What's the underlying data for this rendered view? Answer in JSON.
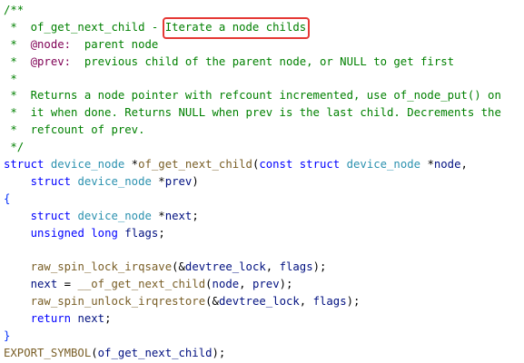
{
  "colors": {
    "background": "#ffffff",
    "comment": "#008000",
    "doc_tag": "#7f0055",
    "keyword": "#0000ff",
    "type": "#2b91af",
    "function": "#795e26",
    "variable": "#001080",
    "brace": "#0431fa",
    "highlight_box": "#e53935"
  },
  "code": {
    "lines": [
      {
        "tokens": [
          {
            "text": "/**",
            "cls": "c-comment"
          }
        ]
      },
      {
        "tokens": [
          {
            "text": " *  of_get_next_child - ",
            "cls": "c-comment"
          },
          {
            "text": "Iterate a node childs",
            "cls": "c-comment",
            "highlight": true
          }
        ]
      },
      {
        "tokens": [
          {
            "text": " *  ",
            "cls": "c-comment"
          },
          {
            "text": "@node:",
            "cls": "c-doctag"
          },
          {
            "text": "  parent node",
            "cls": "c-comment"
          }
        ]
      },
      {
        "tokens": [
          {
            "text": " *  ",
            "cls": "c-comment"
          },
          {
            "text": "@prev:",
            "cls": "c-doctag"
          },
          {
            "text": "  previous child of the parent node, or NULL to get first",
            "cls": "c-comment"
          }
        ]
      },
      {
        "tokens": [
          {
            "text": " *",
            "cls": "c-comment"
          }
        ]
      },
      {
        "tokens": [
          {
            "text": " *  Returns a node pointer with refcount incremented, use of_node_put() on",
            "cls": "c-comment"
          }
        ]
      },
      {
        "tokens": [
          {
            "text": " *  it when done. Returns NULL when prev is the last child. Decrements the",
            "cls": "c-comment"
          }
        ]
      },
      {
        "tokens": [
          {
            "text": " *  refcount of prev.",
            "cls": "c-comment"
          }
        ]
      },
      {
        "tokens": [
          {
            "text": " */",
            "cls": "c-comment"
          }
        ]
      },
      {
        "tokens": [
          {
            "text": "struct",
            "cls": "c-keyword"
          },
          {
            "text": " ",
            "cls": "c-punct"
          },
          {
            "text": "device_node",
            "cls": "c-type"
          },
          {
            "text": " *",
            "cls": "c-punct"
          },
          {
            "text": "of_get_next_child",
            "cls": "c-func"
          },
          {
            "text": "(",
            "cls": "c-punct"
          },
          {
            "text": "const",
            "cls": "c-keyword"
          },
          {
            "text": " ",
            "cls": "c-punct"
          },
          {
            "text": "struct",
            "cls": "c-keyword"
          },
          {
            "text": " ",
            "cls": "c-punct"
          },
          {
            "text": "device_node",
            "cls": "c-type"
          },
          {
            "text": " *",
            "cls": "c-punct"
          },
          {
            "text": "node",
            "cls": "c-var"
          },
          {
            "text": ",",
            "cls": "c-punct"
          }
        ]
      },
      {
        "tokens": [
          {
            "text": "    ",
            "cls": "c-punct"
          },
          {
            "text": "struct",
            "cls": "c-keyword"
          },
          {
            "text": " ",
            "cls": "c-punct"
          },
          {
            "text": "device_node",
            "cls": "c-type"
          },
          {
            "text": " *",
            "cls": "c-punct"
          },
          {
            "text": "prev",
            "cls": "c-var"
          },
          {
            "text": ")",
            "cls": "c-punct"
          }
        ]
      },
      {
        "tokens": [
          {
            "text": "{",
            "cls": "c-brace"
          }
        ]
      },
      {
        "tokens": [
          {
            "text": "    ",
            "cls": "c-punct"
          },
          {
            "text": "struct",
            "cls": "c-keyword"
          },
          {
            "text": " ",
            "cls": "c-punct"
          },
          {
            "text": "device_node",
            "cls": "c-type"
          },
          {
            "text": " *",
            "cls": "c-punct"
          },
          {
            "text": "next",
            "cls": "c-var"
          },
          {
            "text": ";",
            "cls": "c-punct"
          }
        ]
      },
      {
        "tokens": [
          {
            "text": "    ",
            "cls": "c-punct"
          },
          {
            "text": "unsigned",
            "cls": "c-keyword"
          },
          {
            "text": " ",
            "cls": "c-punct"
          },
          {
            "text": "long",
            "cls": "c-keyword"
          },
          {
            "text": " ",
            "cls": "c-punct"
          },
          {
            "text": "flags",
            "cls": "c-var"
          },
          {
            "text": ";",
            "cls": "c-punct"
          }
        ]
      },
      {
        "tokens": [
          {
            "text": "",
            "cls": "c-punct"
          }
        ]
      },
      {
        "tokens": [
          {
            "text": "    ",
            "cls": "c-punct"
          },
          {
            "text": "raw_spin_lock_irqsave",
            "cls": "c-func"
          },
          {
            "text": "(&",
            "cls": "c-punct"
          },
          {
            "text": "devtree_lock",
            "cls": "c-var"
          },
          {
            "text": ", ",
            "cls": "c-punct"
          },
          {
            "text": "flags",
            "cls": "c-var"
          },
          {
            "text": ");",
            "cls": "c-punct"
          }
        ]
      },
      {
        "tokens": [
          {
            "text": "    ",
            "cls": "c-punct"
          },
          {
            "text": "next",
            "cls": "c-var"
          },
          {
            "text": " = ",
            "cls": "c-punct"
          },
          {
            "text": "__of_get_next_child",
            "cls": "c-func"
          },
          {
            "text": "(",
            "cls": "c-punct"
          },
          {
            "text": "node",
            "cls": "c-var"
          },
          {
            "text": ", ",
            "cls": "c-punct"
          },
          {
            "text": "prev",
            "cls": "c-var"
          },
          {
            "text": ");",
            "cls": "c-punct"
          }
        ]
      },
      {
        "tokens": [
          {
            "text": "    ",
            "cls": "c-punct"
          },
          {
            "text": "raw_spin_unlock_irqrestore",
            "cls": "c-func"
          },
          {
            "text": "(&",
            "cls": "c-punct"
          },
          {
            "text": "devtree_lock",
            "cls": "c-var"
          },
          {
            "text": ", ",
            "cls": "c-punct"
          },
          {
            "text": "flags",
            "cls": "c-var"
          },
          {
            "text": ");",
            "cls": "c-punct"
          }
        ]
      },
      {
        "tokens": [
          {
            "text": "    ",
            "cls": "c-punct"
          },
          {
            "text": "return",
            "cls": "c-keyword"
          },
          {
            "text": " ",
            "cls": "c-punct"
          },
          {
            "text": "next",
            "cls": "c-var"
          },
          {
            "text": ";",
            "cls": "c-punct"
          }
        ]
      },
      {
        "tokens": [
          {
            "text": "}",
            "cls": "c-brace"
          }
        ]
      },
      {
        "tokens": [
          {
            "text": "EXPORT_SYMBOL",
            "cls": "c-macro"
          },
          {
            "text": "(",
            "cls": "c-punct"
          },
          {
            "text": "of_get_next_child",
            "cls": "c-var"
          },
          {
            "text": ");",
            "cls": "c-punct"
          }
        ]
      }
    ]
  }
}
